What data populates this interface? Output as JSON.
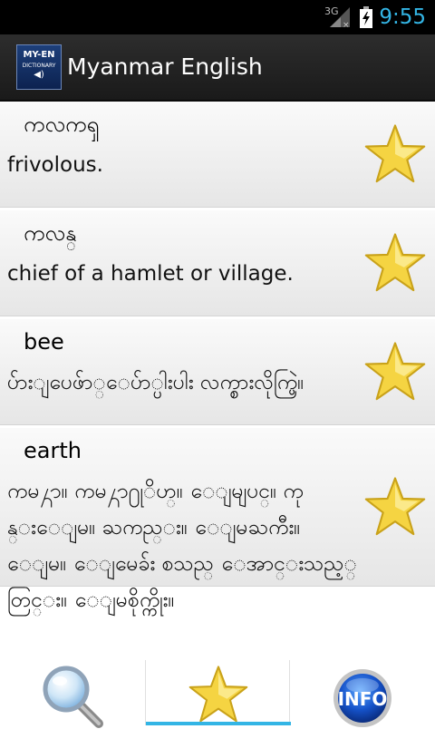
{
  "status_bar": {
    "network": "3G",
    "time": "9:55"
  },
  "action_bar": {
    "logo": {
      "line1": "MY-EN",
      "line2": "DICTIONARY",
      "icon": "speaker-icon"
    },
    "title": "Myanmar English"
  },
  "favorites": [
    {
      "headword": "ကလကၡ",
      "definition": "frivolous.",
      "starred": true
    },
    {
      "headword": "ကလန္",
      "definition": "chief of a hamlet or village.",
      "starred": true
    },
    {
      "headword": "bee",
      "definition": "ပ်ားျပေဖ်ာ္ေပ်ာ္ပါးပါး လက္စားလိုက္ပြဲ။",
      "starred": true
    },
    {
      "headword": "earth",
      "definition": "ကမ႓ာ။ ကမ႓ာ႐ုိဟ္။ ေျမျပင္။ ကုန္းေျမ။ ႀကည္း။ ေျမႀကီး။ ေျမ။ ေျမေခ်း စသည္ ေအာင္းသည့္ တြင္း။ ေျမစိုက္ကိုး။",
      "starred": true
    }
  ],
  "bottom_nav": {
    "tabs": [
      {
        "name": "search",
        "icon": "magnifier-icon"
      },
      {
        "name": "favorites",
        "icon": "star-icon",
        "selected": true
      },
      {
        "name": "info",
        "icon": "info-icon",
        "label": "INFO"
      }
    ]
  },
  "colors": {
    "accent": "#33b5e5",
    "star_fill": "#f5d442",
    "star_outline": "#c9a21a"
  }
}
